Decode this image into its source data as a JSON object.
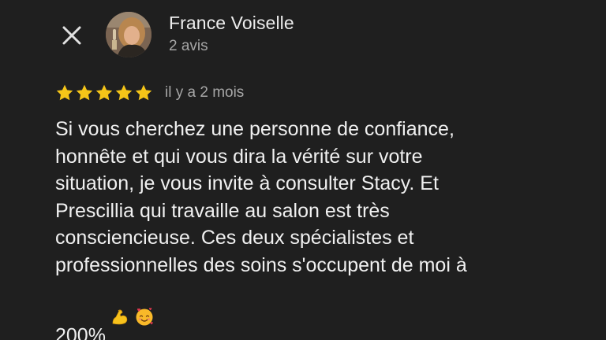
{
  "header": {
    "close_icon": "close-icon",
    "author_name": "France Voiselle",
    "author_meta": "2 avis",
    "avatar_icon": "profile-photo"
  },
  "rating": {
    "stars": 5,
    "max_stars": 5,
    "star_color": "#f5c518",
    "time": "il y a 2 mois"
  },
  "review": {
    "text": "Si vous cherchez une personne de confiance,\nhonnête et qui vous dira la vérité sur votre\nsituation,  je vous invite à consulter Stacy.  Et\nPrescillia qui travaille au salon est très\nconsciencieuse.   Ces deux spécialistes et\nprofessionnelles des soins s'occupent de moi à\n200%",
    "emojis": [
      "flexed-biceps-emoji",
      "smiling-face-with-hearts-emoji"
    ]
  },
  "colors": {
    "background": "#1f1f1f",
    "primary_text": "#f0f0f0",
    "secondary_text": "#a6a6a6"
  }
}
